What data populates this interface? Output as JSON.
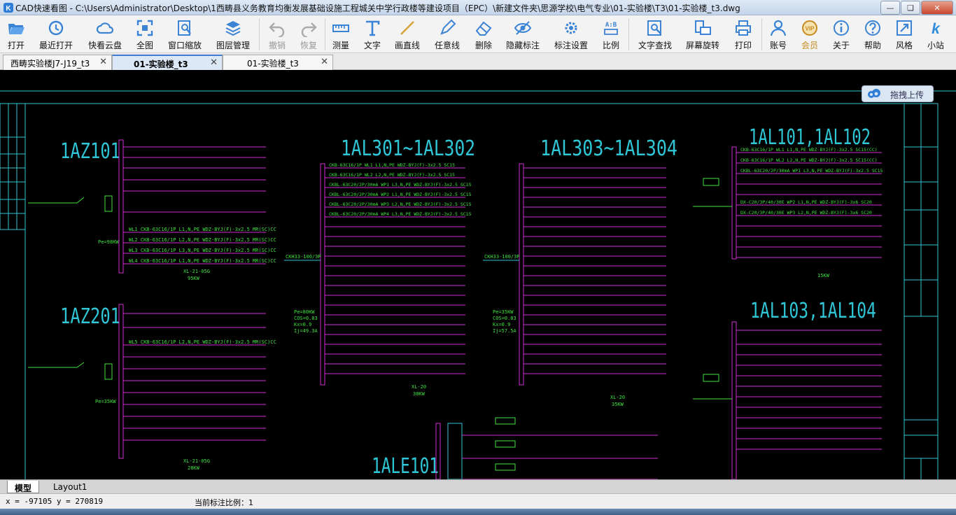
{
  "window": {
    "app_name": "CAD快速看图",
    "title": "CAD快速看图 - C:\\Users\\Administrator\\Desktop\\1西畴县义务教育均衡发展基础设施工程城关中学行政楼等建设项目（EPC）\\新建文件夹\\思源学校\\电气专业\\01-实验楼\\T3\\01-实验楼_t3.dwg",
    "buttons": [
      "minimize",
      "maximize",
      "close"
    ]
  },
  "toolbar": {
    "items": [
      {
        "label": "打开",
        "icon": "folder-open-icon"
      },
      {
        "label": "最近打开",
        "icon": "recent-clock-icon"
      },
      {
        "label": "快看云盘",
        "icon": "cloud-icon"
      },
      {
        "label": "全图",
        "icon": "fit-all-icon"
      },
      {
        "label": "窗口缩放",
        "icon": "window-zoom-icon"
      },
      {
        "label": "图层管理",
        "icon": "layers-icon"
      },
      {
        "label": "撤销",
        "icon": "undo-icon",
        "disabled": true
      },
      {
        "label": "恢复",
        "icon": "redo-icon",
        "disabled": true
      },
      {
        "label": "测量",
        "icon": "ruler-icon"
      },
      {
        "label": "文字",
        "icon": "text-icon"
      },
      {
        "label": "画直线",
        "icon": "line-icon"
      },
      {
        "label": "任意线",
        "icon": "pen-icon"
      },
      {
        "label": "删除",
        "icon": "eraser-icon"
      },
      {
        "label": "隐藏标注",
        "icon": "eye-icon"
      },
      {
        "label": "标注设置",
        "icon": "gear-icon"
      },
      {
        "label": "比例",
        "icon": "scale-ab-icon"
      },
      {
        "label": "文字查找",
        "icon": "text-search-icon"
      },
      {
        "label": "屏幕旋转",
        "icon": "rotate-screen-icon"
      },
      {
        "label": "打印",
        "icon": "printer-icon"
      },
      {
        "label": "账号",
        "icon": "user-icon"
      },
      {
        "label": "会员",
        "icon": "vip-icon",
        "vip": true
      },
      {
        "label": "关于",
        "icon": "info-icon"
      },
      {
        "label": "帮助",
        "icon": "help-icon"
      },
      {
        "label": "风格",
        "icon": "style-icon"
      },
      {
        "label": "小站",
        "icon": "k-logo-icon"
      }
    ]
  },
  "tabs": [
    {
      "label": "西畴实验楼J7-J19_t3",
      "active": false
    },
    {
      "label": "01-实验楼_t3",
      "active": true
    },
    {
      "label": "01-实验楼_t3",
      "active": false
    }
  ],
  "upload_button": {
    "label": "拖拽上传",
    "icon": "cloud-upload-icon"
  },
  "drawing": {
    "panel_titles": [
      "1AZ101",
      "1AL301~1AL302",
      "1AL303~1AL304",
      "1AL101,1AL102",
      "1AZ201",
      "1AL103,1AL104",
      "1ALE101"
    ],
    "annotations": {
      "az101_power": "95KW",
      "az201_power": "28KW",
      "al301_pe": "Pe=80KW",
      "al301_cos": "COS=0.83",
      "al301_kx": "Kx=0.9",
      "al301_ij": "Ij=49.3A",
      "al303_pe": "Pe=35KW",
      "al303_cos": "COS=0.83",
      "al303_kx": "Kx=0.9",
      "al303_ij": "Ij=57.5A",
      "az101_pe": "Pe=98KW",
      "az201_pe": "Pe=35KW",
      "cable_az101": "XL-21-05G",
      "cable_az201": "XL-21-05G",
      "al301_box": "XL-20",
      "al301_kw": "30KW",
      "al303_box": "XL-20",
      "al303_kw": "35KW",
      "al101_kw": "15KW",
      "breaker_1": "CKH33-100/3P",
      "breaker_2": "CKH33-100/3P"
    },
    "circuit_rows_left": [
      "WL1  CKB-63C16/1P L1,N,PE  WDZ-BYJ(F)-3x2.5 MR(SC)CC",
      "WL2  CKB-63C16/1P L2,N,PE  WDZ-BYJ(F)-3x2.5 MR(SC)CC",
      "WL3  CKB-63C16/1P L3,N,PE  WDZ-BYJ(F)-3x2.5 MR(SC)CC",
      "WL4  CKB-63C16/1P L1,N,PE  WDZ-BYJ(F)-3x2.5 MR(SC)CC",
      "WL5  CKB-63C16/1P L2,N,PE  WDZ-BYJ(F)-3x2.5 MR(SC)CC"
    ],
    "circuit_rows_mid": [
      "CKB-63C16/1P WL1  L1,N,PE   WDZ-BYJ(F)-3x2.5 SC15",
      "CKB-63C16/1P WL2  L2,N,PE   WDZ-BYJ(F)-3x2.5 SC15",
      "CKBL-63C20/2P/30mA WP1 L3,N,PE WDZ-BYJ(F)-3x2.5 SC15",
      "CKBL-63C20/2P/30mA WP2 L1,N,PE WDZ-BYJ(F)-3x2.5 SC15",
      "CKBL-63C20/2P/30mA WP3 L2,N,PE WDZ-BYJ(F)-3x2.5 SC15",
      "CKBL-63C20/2P/30mA WP4 L3,N,PE WDZ-BYJ(F)-3x2.5 SC15"
    ],
    "circuit_rows_right": [
      "CKB-63C16/1P WL1  L1,N,PE  WDZ-BYJ(F)-3x2.5 SC15(CC)",
      "CKB-63C16/1P WL2  L2,N,PE  WDZ-BYJ(F)-3x2.5 SC15(CC)",
      "CKBL-63C20/2P/30mA WP1  L3,N,PE WDZ-BYJ(F)-3x2.5 SC15",
      "DX-C20/3P/40/30E  WP2 L1,N,PE WDZ-BYJ(F)-3x6 SC20",
      "DX-C20/3P/40/30E  WP3 L2,N,PE WDZ-BYJ(F)-3x6 SC20"
    ]
  },
  "layout_tabs": [
    {
      "label": "模型",
      "active": true
    },
    {
      "label": "Layout1",
      "active": false
    }
  ],
  "status": {
    "coords": "x = -97105  y = 270819",
    "scale_label": "当前标注比例：1"
  }
}
